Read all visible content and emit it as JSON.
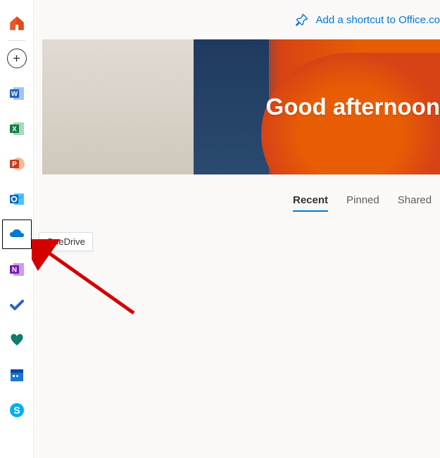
{
  "sidebar": {
    "items": [
      {
        "name": "home",
        "label": "Home"
      },
      {
        "name": "create",
        "label": "Create"
      },
      {
        "name": "word",
        "label": "Word"
      },
      {
        "name": "excel",
        "label": "Excel"
      },
      {
        "name": "powerpoint",
        "label": "PowerPoint"
      },
      {
        "name": "outlook",
        "label": "Outlook"
      },
      {
        "name": "onedrive",
        "label": "OneDrive"
      },
      {
        "name": "onenote",
        "label": "OneNote"
      },
      {
        "name": "todo",
        "label": "To Do"
      },
      {
        "name": "family",
        "label": "Family Safety"
      },
      {
        "name": "calendar",
        "label": "Calendar"
      },
      {
        "name": "skype",
        "label": "Skype"
      }
    ]
  },
  "tooltip": {
    "text": "OneDrive"
  },
  "topbar": {
    "shortcut_label": "Add a shortcut to Office.co"
  },
  "hero": {
    "greeting": "Good afternoon"
  },
  "tabs": {
    "items": [
      {
        "label": "Recent",
        "active": true
      },
      {
        "label": "Pinned",
        "active": false
      },
      {
        "label": "Shared",
        "active": false
      }
    ]
  }
}
